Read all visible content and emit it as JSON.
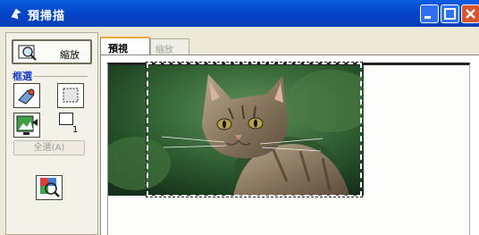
{
  "window": {
    "title": "預掃描",
    "controls": {
      "minimize": "minimize-icon",
      "maximize": "maximize-icon",
      "close": "close-icon"
    }
  },
  "toolbar": {
    "zoom_label": "縮放",
    "frame_section_label": "框選",
    "frame_count": "1",
    "select_all_label": "全選(A)"
  },
  "tabs": [
    {
      "label": "預視",
      "active": true
    },
    {
      "label": "縮放",
      "active": false
    }
  ],
  "colors": {
    "title_bar": "#0a4fd6",
    "active_tab_accent": "#f3a73b",
    "frame_label": "#1a3cc8"
  }
}
